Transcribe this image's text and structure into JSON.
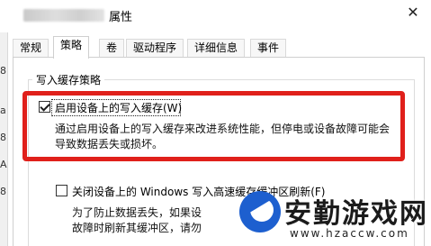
{
  "window": {
    "title_suffix": "属性",
    "close_glyph": "✕"
  },
  "tabs": [
    {
      "label": "常规"
    },
    {
      "label": "策略"
    },
    {
      "label": "卷"
    },
    {
      "label": "驱动程序"
    },
    {
      "label": "详细信息"
    },
    {
      "label": "事件"
    }
  ],
  "policy": {
    "group_title": "写入缓存策略",
    "enable_cache": {
      "label": "启用设备上的写入缓存(W)",
      "checked": true,
      "desc_line1": "通过启用设备上的写入缓存来改进系统性能，但停电或设备故障可能会",
      "desc_line2": "导致数据丢失或损坏。"
    },
    "disable_flush": {
      "label": "关闭设备上的 Windows 写入高速缓存缓冲区刷新(F)",
      "checked": false,
      "desc_line1": "为了防止数据丢失，如果设",
      "desc_line2": "故障时刷新其缓冲区，请勿"
    }
  },
  "background_strip": [
    "8",
    "a",
    "8",
    "A",
    "8"
  ],
  "watermark": {
    "text": "安勤游戏网",
    "url": "www.hzaccw.com"
  },
  "colors": {
    "highlight_border": "#e0201b",
    "watermark_blue": "#1d5fcf"
  }
}
